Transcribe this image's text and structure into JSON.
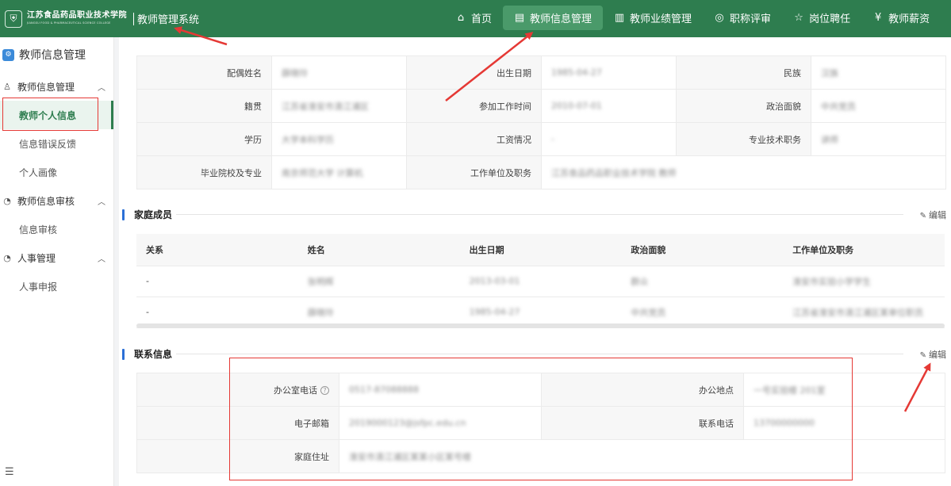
{
  "header": {
    "logo_cn": "江苏食品药品职业技术学院",
    "logo_en": "JIANGSU FOOD & PHARMACEUTICAL SCIENCE COLLEGE",
    "system_title": "教师管理系统",
    "nav": [
      {
        "icon": "home-icon",
        "label": "首页"
      },
      {
        "icon": "document-icon",
        "label": "教师信息管理"
      },
      {
        "icon": "bar-chart-icon",
        "label": "教师业绩管理"
      },
      {
        "icon": "medal-icon",
        "label": "职称评审"
      },
      {
        "icon": "star-icon",
        "label": "岗位聘任"
      },
      {
        "icon": "yuan-icon",
        "label": "教师薪资"
      }
    ],
    "active_nav": "教师信息管理"
  },
  "sidebar": {
    "title": "教师信息管理",
    "groups": [
      {
        "label": "教师信息管理",
        "items": [
          "教师个人信息",
          "信息错误反馈",
          "个人画像"
        ]
      },
      {
        "label": "教师信息审核",
        "items": [
          "信息审核"
        ]
      },
      {
        "label": "人事管理",
        "items": [
          "人事申报"
        ]
      }
    ],
    "active_item": "教师个人信息"
  },
  "basic": {
    "rows": [
      [
        {
          "k": "配偶姓名",
          "v": "薛晓玲"
        },
        {
          "k": "出生日期",
          "v": "1985-04-27"
        },
        {
          "k": "民族",
          "v": "汉族"
        }
      ],
      [
        {
          "k": "籍贯",
          "v": "江苏省淮安市清江浦区"
        },
        {
          "k": "参加工作时间",
          "v": "2010-07-01"
        },
        {
          "k": "政治面貌",
          "v": "中共党员"
        }
      ],
      [
        {
          "k": "学历",
          "v": "大学本科学历"
        },
        {
          "k": "工资情况",
          "v": "-"
        },
        {
          "k": "专业技术职务",
          "v": "讲师"
        }
      ],
      [
        {
          "k": "毕业院校及专业",
          "v": "南京师范大学 计算机"
        },
        {
          "k": "工作单位及职务",
          "v": "江苏食品药品职业技术学院 教师"
        }
      ]
    ]
  },
  "family": {
    "title": "家庭成员",
    "edit_label": "编辑",
    "headers": [
      "关系",
      "姓名",
      "出生日期",
      "政治面貌",
      "工作单位及职务"
    ],
    "rows": [
      [
        "-",
        "张明辉",
        "2013-03-01",
        "群众",
        "淮安市实验小学学生"
      ],
      [
        "-",
        "薛晓玲",
        "1985-04-27",
        "中共党员",
        "江苏省淮安市清江浦区某单位职员"
      ]
    ]
  },
  "contact": {
    "title": "联系信息",
    "edit_label": "编辑",
    "office_phone_label": "办公室电话",
    "office_phone": "0517-87088888",
    "office_location_label": "办公地点",
    "office_location": "一号实验楼 201室",
    "email_label": "电子邮箱",
    "email": "2019000123@jsfpc.edu.cn",
    "mobile_label": "联系电话",
    "mobile": "13700000000",
    "address_label": "家庭住址",
    "address": "淮安市清江浦区某某小区某号楼"
  },
  "colors": {
    "header": "#2e7d4f",
    "accent_green": "#2e7d4f",
    "section_bar": "#2b6fd6",
    "annotation_red": "#e53935"
  }
}
